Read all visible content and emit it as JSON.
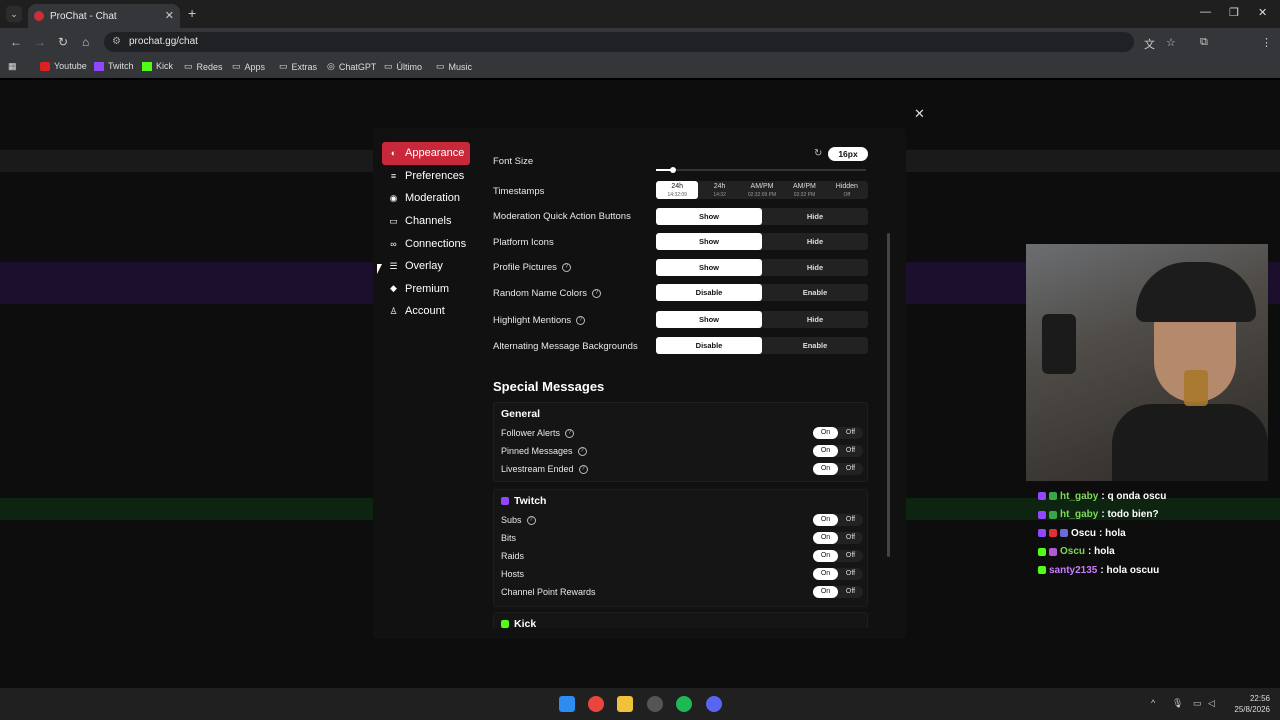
{
  "browser": {
    "tab_title": "ProChat - Chat",
    "url": "prochat.gg/chat",
    "bookmarks": [
      "Youtube",
      "Twitch",
      "Kick",
      "Redes",
      "Apps",
      "Extras",
      "ChatGPT",
      "Último",
      "Music"
    ]
  },
  "settings": {
    "nav": [
      "Appearance",
      "Preferences",
      "Moderation",
      "Channels",
      "Connections",
      "Overlay",
      "Premium",
      "Account"
    ],
    "font_size": {
      "label": "Font Size",
      "value": "16px"
    },
    "timestamps": {
      "label": "Timestamps",
      "options": [
        {
          "main": "24h",
          "sub": "14:32:09"
        },
        {
          "main": "24h",
          "sub": "14:32"
        },
        {
          "main": "AM/PM",
          "sub": "02:32:09 PM"
        },
        {
          "main": "AM/PM",
          "sub": "02:32 PM"
        },
        {
          "main": "Hidden",
          "sub": "Off"
        }
      ]
    },
    "rows": [
      {
        "label": "Moderation Quick Action Buttons",
        "a": "Show",
        "b": "Hide"
      },
      {
        "label": "Platform Icons",
        "a": "Show",
        "b": "Hide"
      },
      {
        "label": "Profile Pictures",
        "a": "Show",
        "b": "Hide"
      },
      {
        "label": "Random Name Colors",
        "a": "Disable",
        "b": "Enable"
      },
      {
        "label": "Highlight Mentions",
        "a": "Show",
        "b": "Hide"
      },
      {
        "label": "Alternating Message Backgrounds",
        "a": "Disable",
        "b": "Enable"
      }
    ],
    "special_title": "Special Messages",
    "general": {
      "title": "General",
      "items": [
        "Follower Alerts",
        "Pinned Messages",
        "Livestream Ended"
      ]
    },
    "twitch": {
      "title": "Twitch",
      "items": [
        "Subs",
        "Bits",
        "Raids",
        "Hosts",
        "Channel Point Rewards"
      ]
    },
    "kick": {
      "title": "Kick"
    },
    "on": "On",
    "off": "Off"
  },
  "overlay_chat": [
    {
      "user": "ht_gaby",
      "msg": ": q onda oscu",
      "color": "#7ed957"
    },
    {
      "user": "ht_gaby",
      "msg": ": todo bien?",
      "color": "#7ed957"
    },
    {
      "user": "Oscu",
      "msg": ": hola",
      "color": "#ffffff"
    },
    {
      "user": "Oscu",
      "msg": ": hola",
      "color": "#7ed957"
    },
    {
      "user": "santy2135",
      "msg": ": hola oscuu",
      "color": "#c77dff"
    }
  ],
  "clock": {
    "time": "22:56",
    "date": "25/8/2026"
  },
  "colors": {
    "accent": "#c8283a"
  }
}
